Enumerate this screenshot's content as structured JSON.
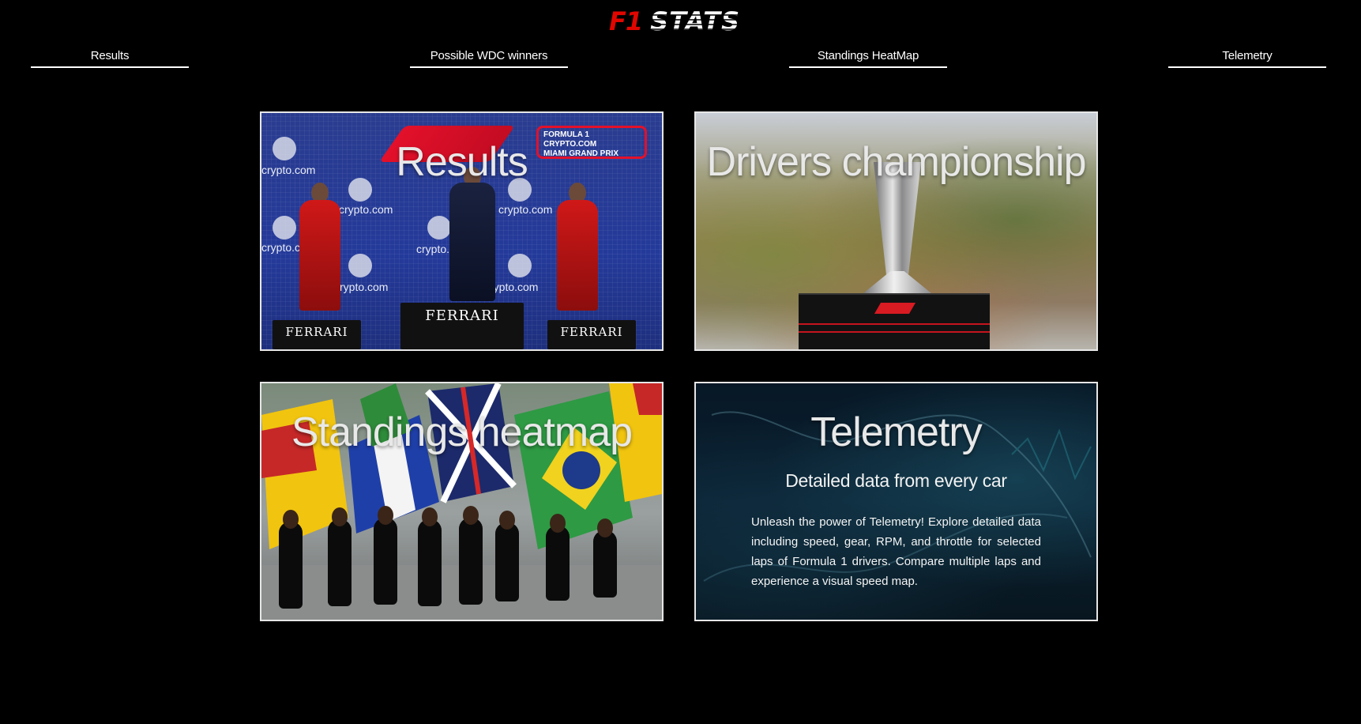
{
  "logo": {
    "f1": "F1",
    "stats": "STATS"
  },
  "nav": {
    "results": "Results",
    "wdc": "Possible WDC winners",
    "heatmap": "Standings HeatMap",
    "telemetry": "Telemetry"
  },
  "cards": {
    "results": {
      "title": "Results",
      "image": {
        "banner_lines": [
          "FORMULA 1",
          "CRYPTO.COM",
          "MIAMI GRAND PRIX"
        ],
        "sponsor": "crypto.com",
        "podium_brand": "FERRARI"
      }
    },
    "drivers": {
      "title": "Drivers championship"
    },
    "heatmap": {
      "title": "Standings heatmap"
    },
    "telemetry": {
      "title": "Telemetry",
      "subtitle": "Detailed data from every car",
      "body": "Unleash the power of Telemetry! Explore detailed data including speed, gear, RPM, and throttle for selected laps of Formula 1 drivers. Compare multiple laps and experience a visual speed map."
    }
  },
  "colors": {
    "background": "#000000",
    "accent_red": "#e10600",
    "card_border": "#e6e6e6",
    "text": "#ffffff"
  }
}
